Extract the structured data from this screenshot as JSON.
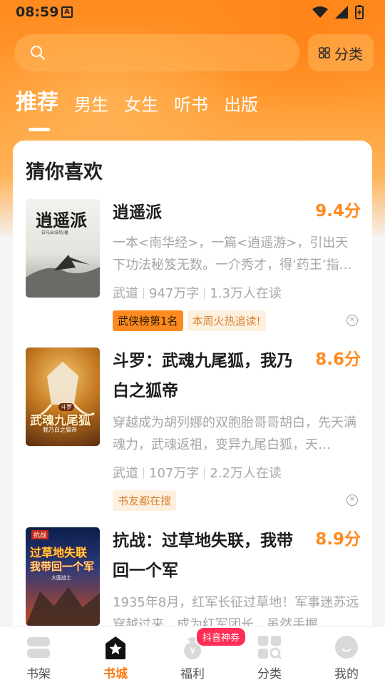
{
  "status_bar": {
    "time": "08:59",
    "notif_badge": "A"
  },
  "search": {
    "placeholder": ""
  },
  "category_button": {
    "label": "分类"
  },
  "tabs": [
    {
      "label": "推荐",
      "active": true
    },
    {
      "label": "男生"
    },
    {
      "label": "女生"
    },
    {
      "label": "听书"
    },
    {
      "label": "出版"
    }
  ],
  "section": {
    "title": "猜你喜欢"
  },
  "books": [
    {
      "title": "逍遥派",
      "score": "9.4分",
      "description": "一本<南华经>，一篇<逍遥游>，引出天下功法秘笈无数。一介秀才，得‘药王’指…",
      "genre": "武道",
      "words": "947万字",
      "readers": "1.3万人在读",
      "tags": [
        "武侠榜第1名",
        "本周火热追读!"
      ],
      "cover_text": "逍遥派",
      "cover_author": "白马出淮苑/著"
    },
    {
      "title": "斗罗：武魂九尾狐，我乃白之狐帝",
      "score": "8.6分",
      "description": "穿越成为胡列娜的双胞胎哥哥胡白，先天满魂力，武魂返祖，变异九尾白狐，天…",
      "genre": "武道",
      "words": "107万字",
      "readers": "2.2万人在读",
      "tags": [
        "书友都在搜"
      ],
      "cover_text": "武魂九尾狐",
      "cover_sub": "我乃白之狐帝",
      "cover_badge": "斗罗"
    },
    {
      "title": "抗战：过草地失联，我带回一个军",
      "score": "8.9分",
      "description": "1935年8月，红军长征过草地！军事迷苏远穿越过来，成为红军团长，虽然手握…",
      "cover_text": "过草地失联",
      "cover_sub": "我带回一个军",
      "cover_badge": "抗战",
      "cover_author": "大国战士"
    }
  ],
  "bottom_nav": [
    {
      "label": "书架",
      "icon": "bookshelf-icon"
    },
    {
      "label": "书城",
      "icon": "bookstore-icon",
      "active": true
    },
    {
      "label": "福利",
      "icon": "welfare-icon"
    },
    {
      "label": "分类",
      "icon": "category-icon"
    },
    {
      "label": "我的",
      "icon": "profile-icon"
    }
  ],
  "promo_badge": "抖音神券",
  "colors": {
    "accent": "#ff8a1f",
    "active_nav": "#ff7a10",
    "promo": "#ff2e56"
  }
}
